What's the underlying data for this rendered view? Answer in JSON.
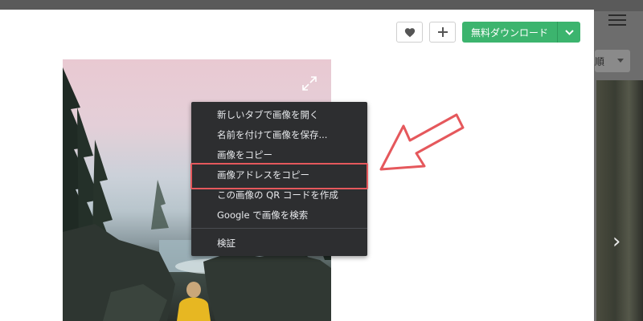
{
  "background": {
    "sort_label": "順",
    "next_arrow": "›"
  },
  "toolbar": {
    "download_label": "無料ダウンロード"
  },
  "context_menu": {
    "items": [
      {
        "label": "新しいタブで画像を開く"
      },
      {
        "label": "名前を付けて画像を保存..."
      },
      {
        "label": "画像をコピー"
      },
      {
        "label": "画像アドレスをコピー",
        "highlighted": true
      },
      {
        "label": "この画像の QR コードを作成"
      },
      {
        "label": "Google で画像を検索"
      },
      {
        "label": "検証"
      }
    ]
  },
  "colors": {
    "accent_green": "#3cb46e",
    "highlight_red": "#e5585c",
    "menu_bg": "#2d2e30"
  },
  "icons": {
    "like": "heart-icon",
    "add": "plus-icon",
    "download_caret": "chevron-down-icon",
    "expand": "expand-icon",
    "menu": "hamburger-menu-icon"
  }
}
